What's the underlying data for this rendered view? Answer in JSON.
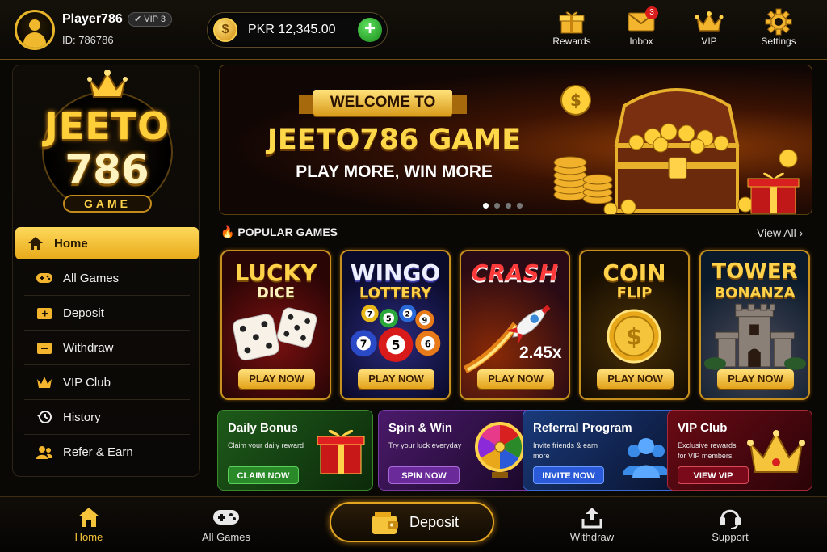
{
  "header": {
    "player_name": "Player786",
    "vip_badge": "VIP 3",
    "player_id": "ID: 786786",
    "balance": "PKR 12,345.00",
    "coin_symbol": "$",
    "add_symbol": "+",
    "inbox_count": "3",
    "nav": [
      {
        "label": "Rewards",
        "icon": "gift-icon"
      },
      {
        "label": "Inbox",
        "icon": "mail-icon"
      },
      {
        "label": "VIP",
        "icon": "crown-icon"
      },
      {
        "label": "Settings",
        "icon": "gear-icon"
      }
    ]
  },
  "logo": {
    "line1": "JEETO",
    "line2": "786",
    "line3": "GAME"
  },
  "sidebar": {
    "items": [
      {
        "label": "Home",
        "icon": "home-icon",
        "active": true
      },
      {
        "label": "All Games",
        "icon": "gamepad-icon"
      },
      {
        "label": "Deposit",
        "icon": "wallet-plus-icon"
      },
      {
        "label": "Withdraw",
        "icon": "wallet-minus-icon"
      },
      {
        "label": "VIP Club",
        "icon": "crown-icon"
      },
      {
        "label": "History",
        "icon": "history-icon"
      },
      {
        "label": "Refer & Earn",
        "icon": "users-icon"
      }
    ]
  },
  "banner": {
    "ribbon": "WELCOME TO",
    "title": "JEETO786 GAME",
    "subtitle": "PLAY MORE, WIN MORE",
    "slides": 4,
    "active_slide": 1
  },
  "popular": {
    "title": "POPULAR GAMES",
    "view_all": "View All",
    "games": [
      {
        "line1": "LUCKY",
        "line2": "DICE",
        "button": "PLAY NOW"
      },
      {
        "line1": "WINGO",
        "line2": "LOTTERY",
        "button": "PLAY NOW"
      },
      {
        "line1": "CRASH",
        "line2": "",
        "multiplier": "2.45x",
        "button": "PLAY NOW"
      },
      {
        "line1": "COIN",
        "line2": "FLIP",
        "button": "PLAY NOW"
      },
      {
        "line1": "TOWER",
        "line2": "BONANZA",
        "button": "PLAY NOW"
      }
    ],
    "balls": [
      "7",
      "5",
      "2",
      "9",
      "7",
      "5",
      "6"
    ]
  },
  "promos": [
    {
      "title": "Daily Bonus",
      "desc": "Claim your daily reward",
      "button": "CLAIM NOW"
    },
    {
      "title": "Spin & Win",
      "desc": "Try your luck everyday",
      "button": "SPIN NOW"
    },
    {
      "title": "Referral Program",
      "desc": "Invite friends & earn more",
      "button": "INVITE NOW"
    },
    {
      "title": "VIP Club",
      "desc": "Exclusive rewards for VIP members",
      "button": "VIEW VIP"
    }
  ],
  "bottom_nav": [
    {
      "label": "Home",
      "icon": "home-icon",
      "active": true
    },
    {
      "label": "All Games",
      "icon": "gamepad-icon"
    },
    {
      "label": "Deposit",
      "icon": "wallet-icon"
    },
    {
      "label": "Withdraw",
      "icon": "upload-icon"
    },
    {
      "label": "Support",
      "icon": "headset-icon"
    }
  ],
  "colors": {
    "gold": "#f6c43b",
    "background": "#0a0805",
    "accent_green": "#2fb34a"
  }
}
